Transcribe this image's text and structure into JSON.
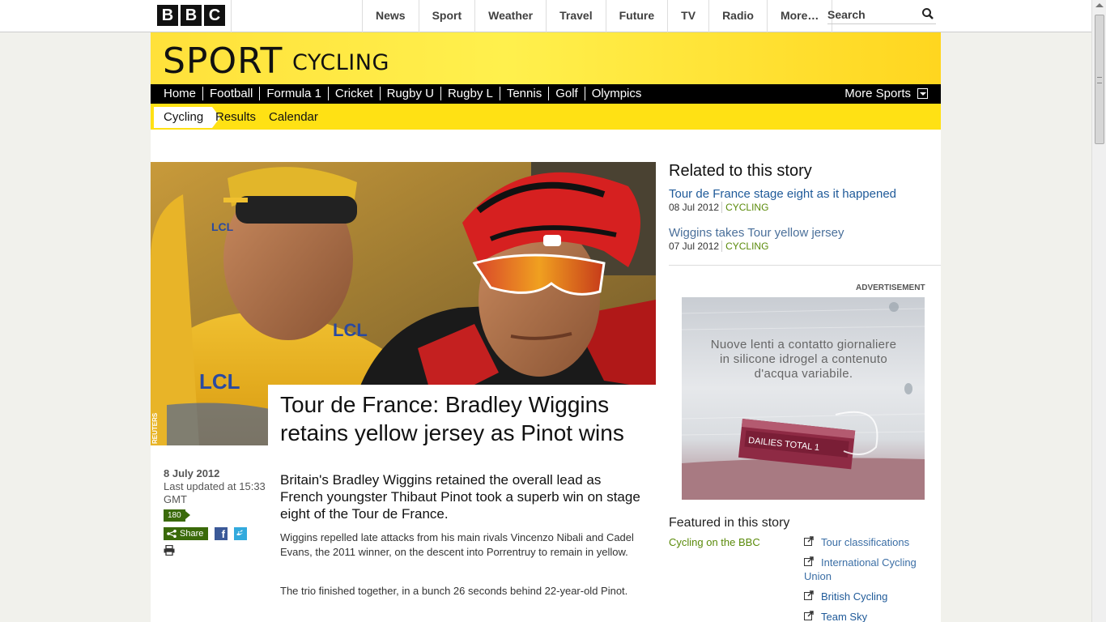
{
  "bbc": {
    "logo_letters": [
      "B",
      "B",
      "C"
    ]
  },
  "global_nav": [
    "News",
    "Sport",
    "Weather",
    "Travel",
    "Future",
    "TV",
    "Radio",
    "More…"
  ],
  "search": {
    "placeholder": "Search"
  },
  "header": {
    "sport": "SPORT",
    "section": "CYCLING"
  },
  "sport_nav": {
    "items": [
      "Home",
      "Football",
      "Formula 1",
      "Cricket",
      "Rugby U",
      "Rugby L",
      "Tennis",
      "Golf",
      "Olympics"
    ],
    "more": "More Sports"
  },
  "sub_nav": [
    "Cycling",
    "Results",
    "Calendar"
  ],
  "article": {
    "image_credit": "REUTERS",
    "headline": "Tour de France: Bradley Wiggins retains yellow jersey as Pinot wins",
    "date": "8 July 2012",
    "updated": "Last updated at 15:33 GMT",
    "comments": "180",
    "share": "Share",
    "intro": "Britain's Bradley Wiggins retained the overall lead as French youngster Thibaut Pinot took a superb win on stage eight of the Tour de France.",
    "paragraphs": [
      "Wiggins repelled late attacks from his main rivals Vincenzo Nibali and Cadel Evans, the 2011 winner, on the descent into Porrentruy to remain in yellow.",
      "The trio finished together, in a bunch 26 seconds behind 22-year-old Pinot."
    ]
  },
  "related": {
    "heading": "Related to this story",
    "items": [
      {
        "title": "Tour de France stage eight as it happened",
        "date": "08 Jul 2012",
        "tag": "CYCLING"
      },
      {
        "title": "Wiggins takes Tour yellow jersey",
        "date": "07 Jul 2012",
        "tag": "CYCLING"
      }
    ]
  },
  "advert": {
    "label": "ADVERTISEMENT",
    "text": "Nuove lenti a contatto giornaliere in silicone idrogel a contenuto d'acqua variabile."
  },
  "featured": {
    "heading": "Featured in this story",
    "left": "Cycling on the BBC",
    "links": [
      "Tour classifications",
      "International Cycling Union",
      "British Cycling",
      "Team Sky"
    ]
  },
  "colors": {
    "sport_yellow": "#ffe114",
    "nav_black": "#000000",
    "link_blue": "#1f5a99",
    "tag_green": "#5a8a0a"
  }
}
